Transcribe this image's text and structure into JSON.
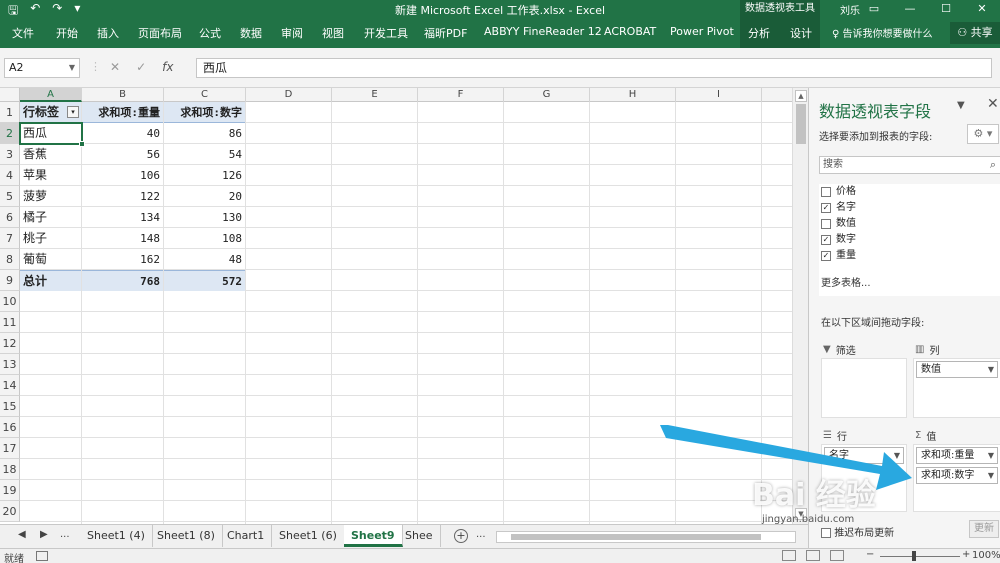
{
  "window": {
    "title": "新建 Microsoft Excel 工作表.xlsx - Excel",
    "context_tab_group": "数据透视表工具",
    "user": "刘乐",
    "qat_save": "🖫",
    "qat_undo": "↶",
    "qat_redo": "↷",
    "qat_more": "▾"
  },
  "ribbon": {
    "tabs": [
      "文件",
      "开始",
      "插入",
      "页面布局",
      "公式",
      "数据",
      "审阅",
      "视图",
      "开发工具",
      "福昕PDF",
      "ABBYY FineReader 12",
      "ACROBAT",
      "Power Pivot",
      "分析",
      "设计"
    ],
    "tell_me": "告诉我你想要做什么",
    "share": "共享"
  },
  "formula_bar": {
    "name_box": "A2",
    "cancel": "✕",
    "enter": "✓",
    "fx": "fx",
    "value": "西瓜"
  },
  "sheet": {
    "columns": [
      "A",
      "B",
      "C",
      "D",
      "E",
      "F",
      "G",
      "H",
      "I"
    ],
    "rows": [
      "1",
      "2",
      "3",
      "4",
      "5",
      "6",
      "7",
      "8",
      "9",
      "10",
      "11",
      "12",
      "13",
      "14",
      "15",
      "16",
      "17",
      "18",
      "19",
      "20"
    ],
    "pivot": {
      "headers": [
        "行标签",
        "求和项:重量",
        "求和项:数字"
      ],
      "filter_glyph": "▾",
      "data": [
        [
          "西瓜",
          "40",
          "86"
        ],
        [
          "香蕉",
          "56",
          "54"
        ],
        [
          "苹果",
          "106",
          "126"
        ],
        [
          "菠萝",
          "122",
          "20"
        ],
        [
          "橘子",
          "134",
          "130"
        ],
        [
          "桃子",
          "148",
          "108"
        ],
        [
          "葡萄",
          "162",
          "48"
        ]
      ],
      "total": [
        "总计",
        "768",
        "572"
      ]
    }
  },
  "sheet_tabs": {
    "nav_prev": "◀",
    "nav_next": "▶",
    "ellipsis": "...",
    "tabs": [
      "Sheet1 (4)",
      "Sheet1 (8)",
      "Chart1",
      "Sheet1 (6)",
      "Sheet9",
      "Shee"
    ],
    "active": "Sheet9",
    "add": "+",
    "more": "..."
  },
  "status_bar": {
    "ready": "就绪",
    "zoom": "100%",
    "zoom_minus": "−",
    "zoom_plus": "+"
  },
  "pivot_pane": {
    "title": "数据透视表字段",
    "subtitle": "选择要添加到报表的字段:",
    "gear": "⚙ ▾",
    "search_placeholder": "搜索",
    "fields": [
      {
        "label": "价格",
        "checked": false
      },
      {
        "label": "名字",
        "checked": true
      },
      {
        "label": "数值",
        "checked": false
      },
      {
        "label": "数字",
        "checked": true
      },
      {
        "label": "重量",
        "checked": true
      }
    ],
    "more_tables": "更多表格...",
    "drag_tip": "在以下区域间拖动字段:",
    "areas": {
      "filters": "筛选",
      "columns": "列",
      "rows": "行",
      "values": "值"
    },
    "column_chips": [
      "数值"
    ],
    "row_chips": [
      "名字"
    ],
    "value_chips": [
      "求和项:重量",
      "求和项:数字"
    ],
    "defer": "推迟布局更新",
    "update": "更新"
  },
  "watermark": {
    "text": "Bai 经验",
    "url": "jingyan.baidu.com"
  },
  "colors": {
    "excel_green": "#217346",
    "arrow": "#29a8e0",
    "pivot_header_fill": "#dde7f3"
  }
}
